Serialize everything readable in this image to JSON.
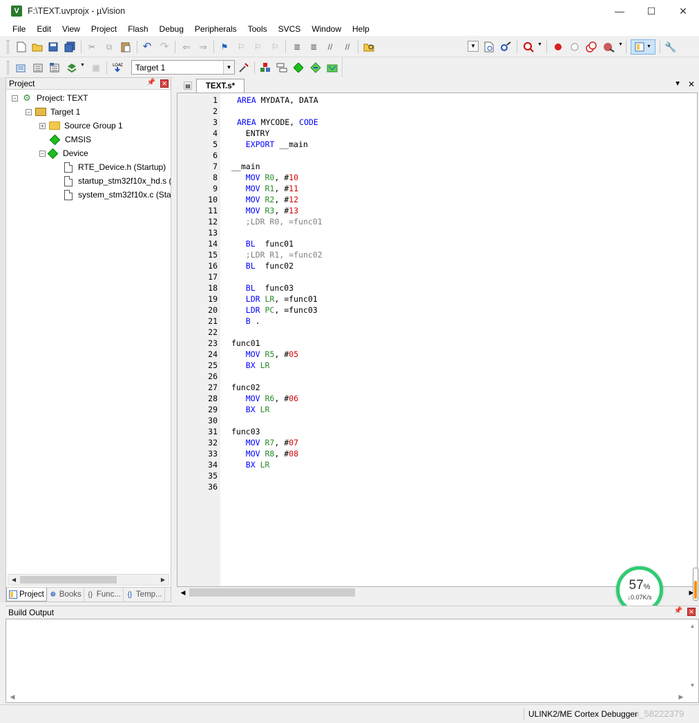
{
  "window": {
    "title": "F:\\TEXT.uvprojx - µVision",
    "app_icon": "V",
    "minimize": "—",
    "maximize": "☐",
    "close": "✕"
  },
  "menu": [
    "File",
    "Edit",
    "View",
    "Project",
    "Flash",
    "Debug",
    "Peripherals",
    "Tools",
    "SVCS",
    "Window",
    "Help"
  ],
  "toolbar2": {
    "target": "Target 1"
  },
  "project_panel": {
    "title": "Project",
    "tree": {
      "project": "Project: TEXT",
      "target": "Target 1",
      "source_group": "Source Group 1",
      "cmsis": "CMSIS",
      "device": "Device",
      "files": [
        "RTE_Device.h (Startup)",
        "startup_stm32f10x_hd.s (",
        "system_stm32f10x.c (Star"
      ]
    },
    "tabs": [
      "Project",
      "Books",
      "Func...",
      "Temp..."
    ]
  },
  "editor": {
    "tab": "TEXT.s*"
  },
  "net_widget": {
    "percent": "57",
    "percent_sign": "%",
    "speed": "↓0.07K/s"
  },
  "build_output": {
    "title": "Build Output"
  },
  "status": {
    "debugger": "ULINK2/ME Cortex Debugger",
    "watermark": "n_58222379"
  }
}
